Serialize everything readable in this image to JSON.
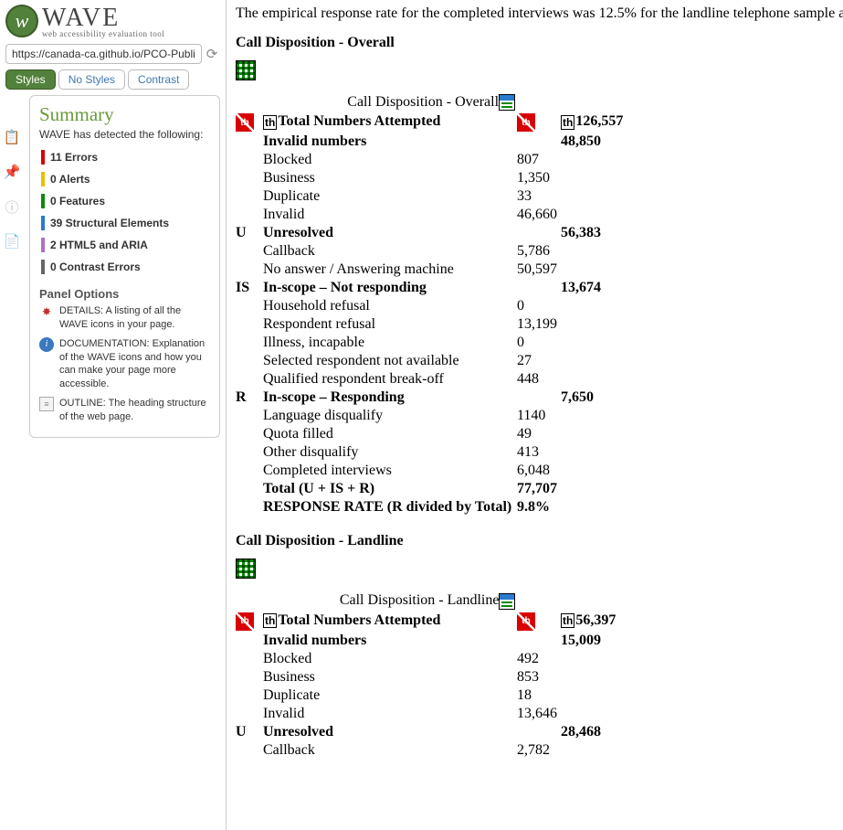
{
  "logo": {
    "title": "WAVE",
    "subtitle": "web accessibility evaluation tool"
  },
  "url": "https://canada-ca.github.io/PCO-Public-O",
  "tabs": {
    "styles": "Styles",
    "nostyles": "No Styles",
    "contrast": "Contrast"
  },
  "summary": {
    "heading": "Summary",
    "detected": "WAVE has detected the following:",
    "items": [
      {
        "count": "11",
        "label": "Errors",
        "color": "red"
      },
      {
        "count": "0",
        "label": "Alerts",
        "color": "yel"
      },
      {
        "count": "0",
        "label": "Features",
        "color": "grn"
      },
      {
        "count": "39",
        "label": "Structural Elements",
        "color": "blu"
      },
      {
        "count": "2",
        "label": "HTML5 and ARIA",
        "color": "pur"
      },
      {
        "count": "0",
        "label": "Contrast Errors",
        "color": "gry"
      }
    ],
    "options_heading": "Panel Options",
    "options": {
      "details": "DETAILS: A listing of all the WAVE icons in your page.",
      "doc": "DOCUMENTATION: Explanation of the WAVE icons and how you can make your page more accessible.",
      "outline": "OUTLINE: The heading structure of the web page."
    }
  },
  "content": {
    "intro": "The empirical response rate for the completed interviews was 12.5% for the landline telephone sample a",
    "overall": {
      "heading": "Call Disposition - Overall",
      "caption": "Call Disposition - Overall",
      "total_label": "Total Numbers Attempted",
      "total_value": "126,557",
      "sections": [
        {
          "code": "",
          "label": "Invalid numbers",
          "total": "48,850",
          "rows": [
            {
              "label": "Blocked",
              "val": "807"
            },
            {
              "label": "Business",
              "val": "1,350"
            },
            {
              "label": "Duplicate",
              "val": "33"
            },
            {
              "label": "Invalid",
              "val": "46,660"
            }
          ]
        },
        {
          "code": "U",
          "label": "Unresolved",
          "total": "56,383",
          "rows": [
            {
              "label": "Callback",
              "val": "5,786"
            },
            {
              "label": "No answer / Answering machine",
              "val": "50,597"
            }
          ]
        },
        {
          "code": "IS",
          "label": "In-scope – Not responding",
          "total": "13,674",
          "rows": [
            {
              "label": "Household refusal",
              "val": "0"
            },
            {
              "label": "Respondent refusal",
              "val": "13,199"
            },
            {
              "label": "Illness, incapable",
              "val": "0"
            },
            {
              "label": "Selected respondent not available",
              "val": "27"
            },
            {
              "label": "Qualified respondent break-off",
              "val": "448"
            }
          ]
        },
        {
          "code": "R",
          "label": "In-scope – Responding",
          "total": "7,650",
          "rows": [
            {
              "label": "Language disqualify",
              "val": "1140"
            },
            {
              "label": "Quota filled",
              "val": "49"
            },
            {
              "label": "Other disqualify",
              "val": "413"
            },
            {
              "label": "Completed interviews",
              "val": "6,048"
            }
          ]
        }
      ],
      "footer": [
        {
          "label": "Total (U + IS + R)",
          "val": "77,707"
        },
        {
          "label": "RESPONSE RATE (R divided by Total)",
          "val": "9.8%"
        }
      ]
    },
    "landline": {
      "heading": "Call Disposition - Landline",
      "caption": "Call Disposition - Landline",
      "total_label": "Total Numbers Attempted",
      "total_value": "56,397",
      "sections": [
        {
          "code": "",
          "label": "Invalid numbers",
          "total": "15,009",
          "rows": [
            {
              "label": "Blocked",
              "val": "492"
            },
            {
              "label": "Business",
              "val": "853"
            },
            {
              "label": "Duplicate",
              "val": "18"
            },
            {
              "label": "Invalid",
              "val": "13,646"
            }
          ]
        },
        {
          "code": "U",
          "label": "Unresolved",
          "total": "28,468",
          "rows": [
            {
              "label": "Callback",
              "val": "2,782"
            }
          ]
        }
      ]
    }
  }
}
